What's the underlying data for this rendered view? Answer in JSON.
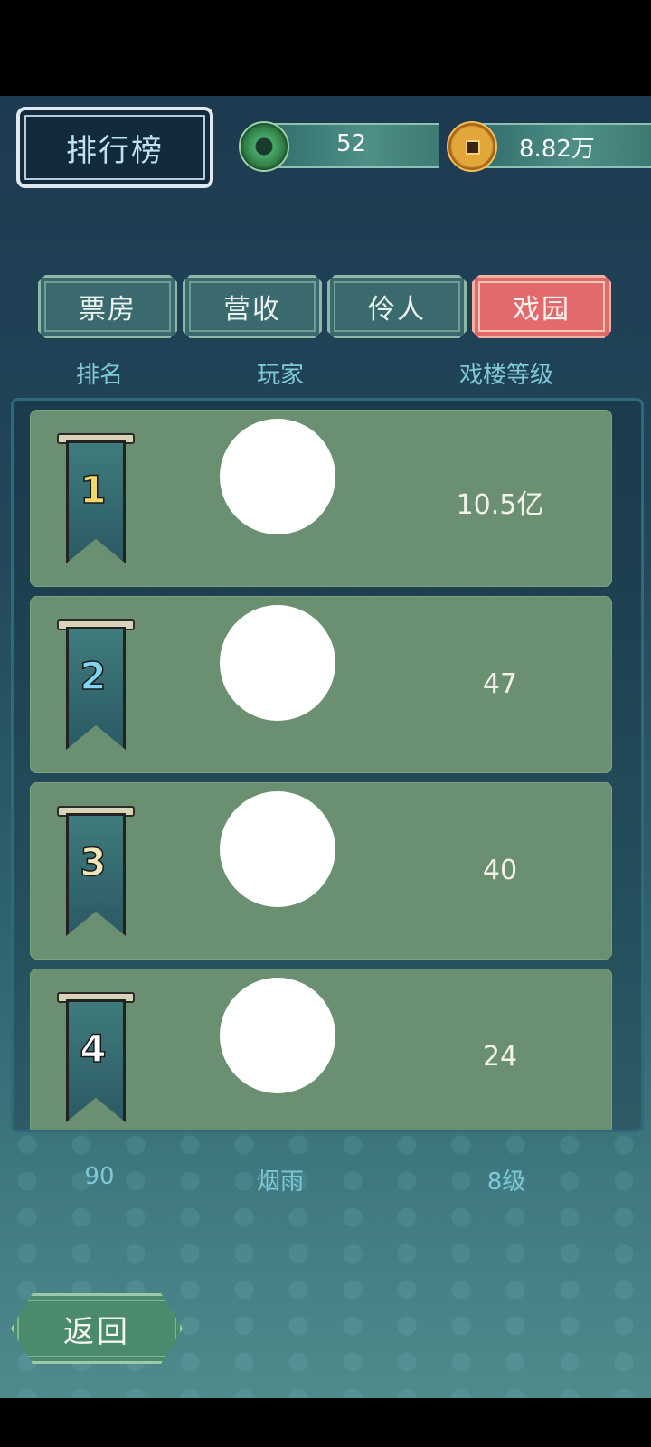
{
  "header": {
    "title": "排行榜",
    "jade_count": "52",
    "coin_count": "8.82万"
  },
  "tabs": [
    {
      "label": "票房",
      "active": false
    },
    {
      "label": "营收",
      "active": false
    },
    {
      "label": "伶人",
      "active": false
    },
    {
      "label": "戏园",
      "active": true
    }
  ],
  "columns": {
    "rank": "排名",
    "player": "玩家",
    "level": "戏楼等级"
  },
  "rows": [
    {
      "rank": "1",
      "value": "10.5亿",
      "rank_color": "#f3d86a"
    },
    {
      "rank": "2",
      "value": "47",
      "rank_color": "#7fd6ee"
    },
    {
      "rank": "3",
      "value": "40",
      "rank_color": "#f1e6b8"
    },
    {
      "rank": "4",
      "value": "24",
      "rank_color": "#ffffff"
    }
  ],
  "self": {
    "rank": "90",
    "name": "烟雨",
    "level": "8级"
  },
  "footer": {
    "back_label": "返回"
  },
  "colors": {
    "active_tab": "#e26a6d",
    "row_bg": "#6a8f71",
    "header_text": "#7ec8d8"
  }
}
